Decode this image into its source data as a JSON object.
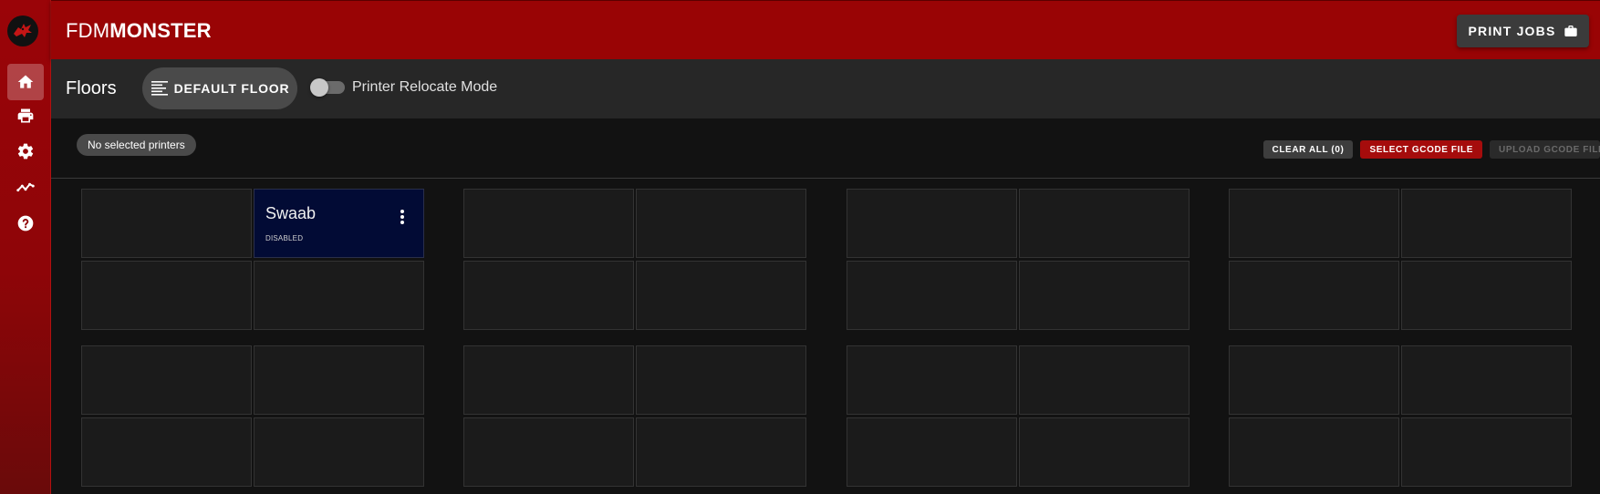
{
  "app": {
    "brand_prefix": "FDM",
    "brand_suffix": "MONSTER",
    "logo_icon": "dragon-logo-icon"
  },
  "sidebar": {
    "items": [
      {
        "icon": "home-icon",
        "active": true
      },
      {
        "icon": "printer-icon",
        "active": false
      },
      {
        "icon": "gear-icon",
        "active": false
      },
      {
        "icon": "chart-line-icon",
        "active": false
      },
      {
        "icon": "help-icon",
        "active": false
      }
    ]
  },
  "topbar": {
    "print_jobs_label": "PRINT JOBS",
    "print_jobs_icon": "briefcase-icon"
  },
  "floorbar": {
    "title": "Floors",
    "floor_chip_label": "DEFAULT FLOOR",
    "floor_chip_icon": "floor-list-icon",
    "relocate_label": "Printer Relocate Mode",
    "relocate_enabled": false
  },
  "selection": {
    "chip_label": "No selected printers",
    "clear_label": "CLEAR ALL (0)",
    "select_gcode_label": "SELECT GCODE FILE",
    "upload_gcode_label": "UPLOAD GCODE FILE"
  },
  "printers": [
    {
      "name": "Swaab",
      "status": "DISABLED"
    }
  ],
  "colors": {
    "brand_red": "#990405",
    "printer_tile": "#020b35",
    "accent_button": "#a50c0c"
  }
}
